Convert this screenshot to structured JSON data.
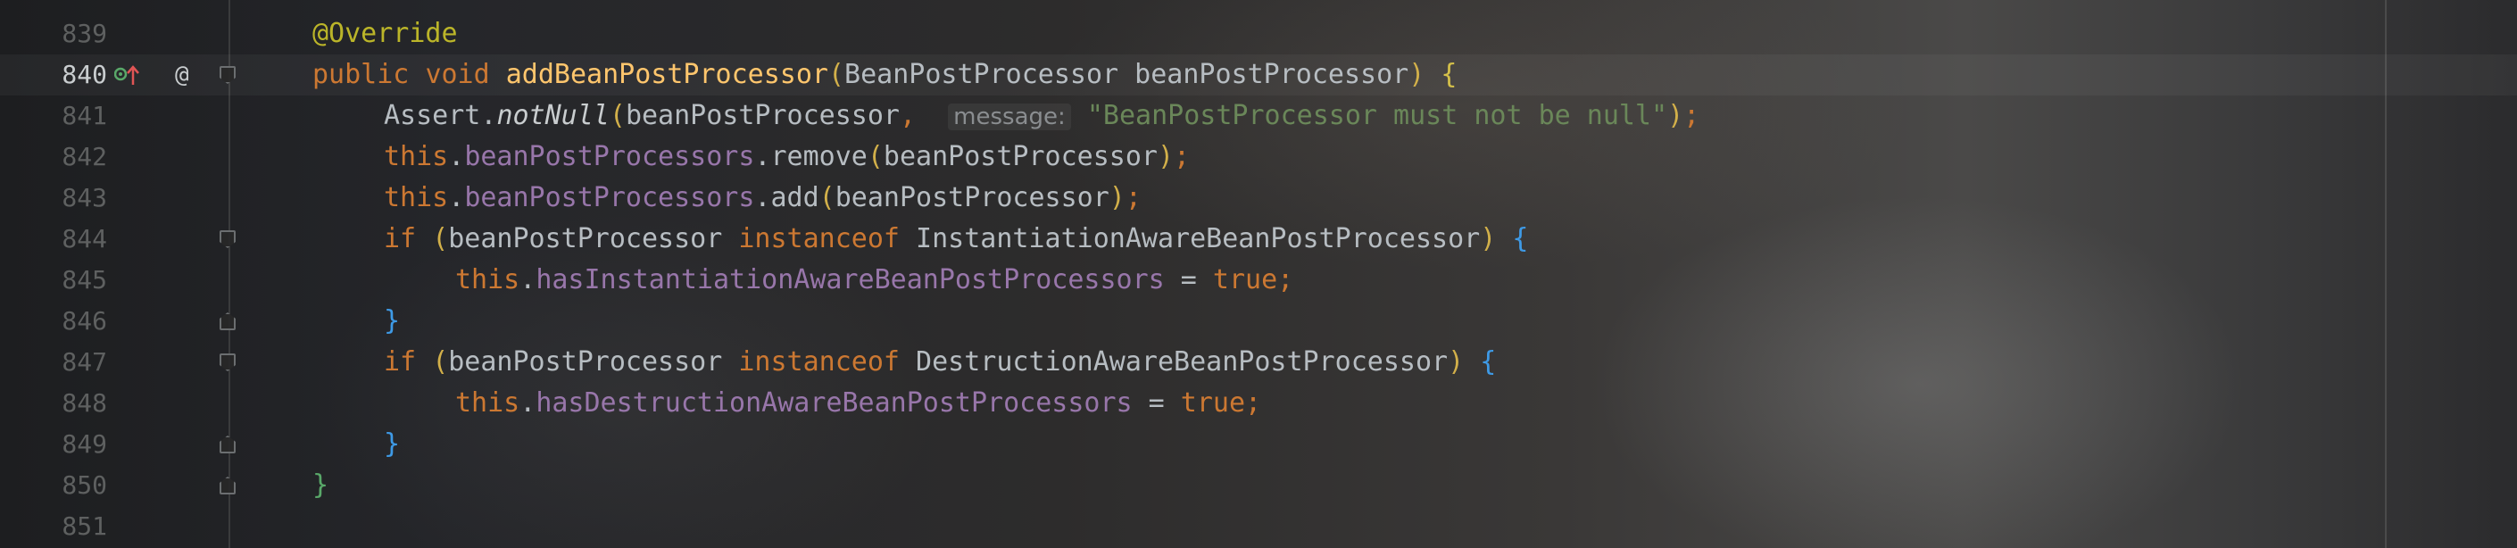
{
  "editor": {
    "lines": [
      {
        "number": "839"
      },
      {
        "number": "840"
      },
      {
        "number": "841"
      },
      {
        "number": "842"
      },
      {
        "number": "843"
      },
      {
        "number": "844"
      },
      {
        "number": "845"
      },
      {
        "number": "846"
      },
      {
        "number": "847"
      },
      {
        "number": "848"
      },
      {
        "number": "849"
      },
      {
        "number": "850"
      },
      {
        "number": "851"
      }
    ],
    "code": {
      "annotation": "@Override",
      "kw_public": "public",
      "kw_void": "void",
      "method_name": "addBeanPostProcessor",
      "param_type": "BeanPostProcessor",
      "param_name": "beanPostProcessor",
      "assert_class": "Assert",
      "assert_method": "notNull",
      "hint_label": "message:",
      "message_string": "\"BeanPostProcessor must not be null\"",
      "kw_this": "this",
      "field_processors": "beanPostProcessors",
      "method_remove": "remove",
      "method_add": "add",
      "kw_if": "if",
      "kw_instanceof": "instanceof",
      "type_instantiation": "InstantiationAwareBeanPostProcessor",
      "field_has_instantiation": "hasInstantiationAwareBeanPostProcessors",
      "kw_true": "true",
      "type_destruction": "DestructionAwareBeanPostProcessor",
      "field_has_destruction": "hasDestructionAwareBeanPostProcessors"
    },
    "gutter_icons": {
      "implementing_icon": "overrides-up-arrow-icon",
      "annotation_marker": "@"
    },
    "colors": {
      "keyword": "#cc7832",
      "annotation": "#bbb529",
      "method": "#ffc66d",
      "field": "#9876aa",
      "string": "#6a8759",
      "brace_blue": "#3e9ae6",
      "brace_green": "#59a869"
    }
  }
}
